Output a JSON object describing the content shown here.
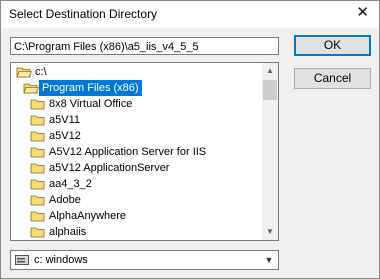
{
  "window": {
    "title": "Select Destination Directory",
    "close_glyph": "✕"
  },
  "path_field": {
    "value": "C:\\Program Files (x86)\\a5_iis_v4_5_5"
  },
  "buttons": {
    "ok": "OK",
    "cancel": "Cancel"
  },
  "tree": {
    "items": [
      {
        "label": "c:\\",
        "icon": "open-folder-icon",
        "level": 0
      },
      {
        "label": "Program Files (x86)",
        "icon": "open-folder-icon",
        "level": 1,
        "selected": true
      },
      {
        "label": "8x8 Virtual Office",
        "icon": "folder-icon",
        "level": 2
      },
      {
        "label": "a5V11",
        "icon": "folder-icon",
        "level": 2
      },
      {
        "label": "a5V12",
        "icon": "folder-icon",
        "level": 2
      },
      {
        "label": "A5V12 Application Server for IIS",
        "icon": "folder-icon",
        "level": 2
      },
      {
        "label": "a5V12 ApplicationServer",
        "icon": "folder-icon",
        "level": 2
      },
      {
        "label": "aa4_3_2",
        "icon": "folder-icon",
        "level": 2
      },
      {
        "label": "Adobe",
        "icon": "folder-icon",
        "level": 2
      },
      {
        "label": "AlphaAnywhere",
        "icon": "folder-icon",
        "level": 2
      },
      {
        "label": "alphaiis",
        "icon": "folder-icon",
        "level": 2
      }
    ]
  },
  "drive_select": {
    "value": "c:  windows",
    "icon": "drive-icon"
  },
  "colors": {
    "selection": "#0078d7",
    "folder": "#f3dc7a",
    "folder_border": "#8a6d1a"
  }
}
